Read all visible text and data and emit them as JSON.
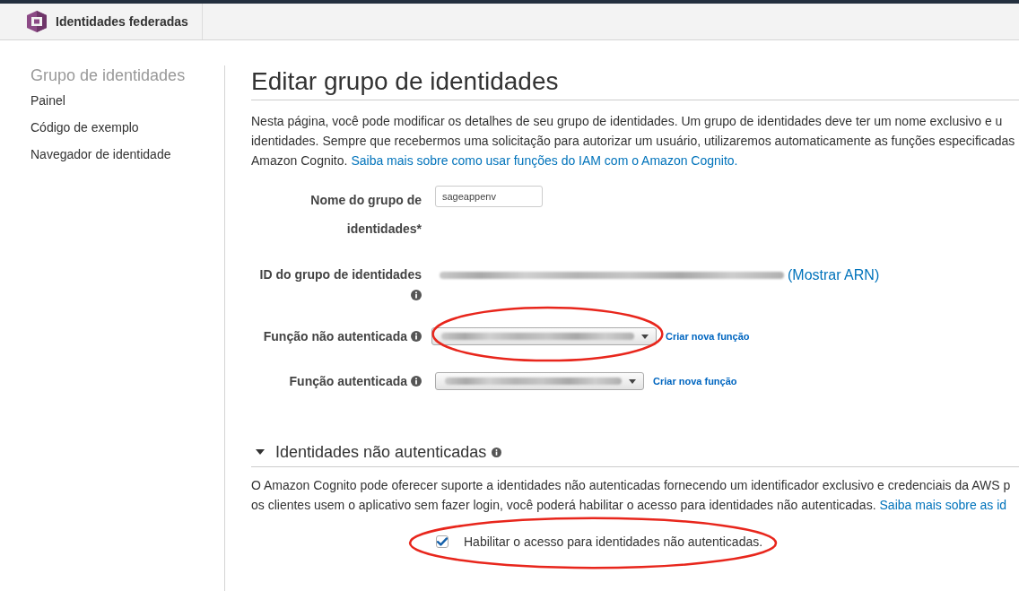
{
  "header": {
    "title": "Identidades federadas"
  },
  "sidebar": {
    "title": "Grupo de identidades",
    "items": [
      "Painel",
      "Código de exemplo",
      "Navegador de identidade"
    ]
  },
  "page": {
    "title": "Editar grupo de identidades",
    "intro": {
      "lines": [
        "Nesta página, você pode modificar os detalhes de seu grupo de identidades. Um grupo de identidades deve ter um nome exclusivo e u",
        "identidades. Sempre que recebermos uma solicitação para autorizar um usuário, utilizaremos automaticamente as funções especificadas",
        "Amazon Cognito."
      ],
      "link": "Saiba mais sobre como usar funções do IAM com o Amazon Cognito."
    },
    "form": [
      {
        "kind": "text_input",
        "label": "Nome do grupo de identidades*",
        "info": false,
        "value": "sageappenv",
        "circled": false
      },
      {
        "kind": "readonly",
        "label": "ID do grupo de identidades",
        "info": true,
        "redacted": true,
        "link": "(Mostrar ARN)",
        "circled": false
      },
      {
        "kind": "dropdown",
        "label": "Função não autenticada",
        "info": true,
        "redacted": true,
        "link": "Criar nova função",
        "circled": true
      },
      {
        "kind": "dropdown",
        "label": "Função autenticada",
        "info": true,
        "redacted": true,
        "link": "Criar nova função",
        "circled": false
      }
    ],
    "unauth_section": {
      "title": "Identidades não autenticadas",
      "expanded": true,
      "info": true,
      "description": {
        "lines": [
          "O Amazon Cognito pode oferecer suporte a identidades não autenticadas fornecendo um identificador exclusivo e credenciais da AWS p",
          "os clientes usem o aplicativo sem fazer login, você poderá habilitar o acesso para identidades não autenticadas."
        ],
        "link": "Saiba mais sobre as id"
      },
      "checkbox": {
        "label": "Habilitar o acesso para identidades não autenticadas.",
        "checked": true,
        "circled": true
      }
    }
  }
}
